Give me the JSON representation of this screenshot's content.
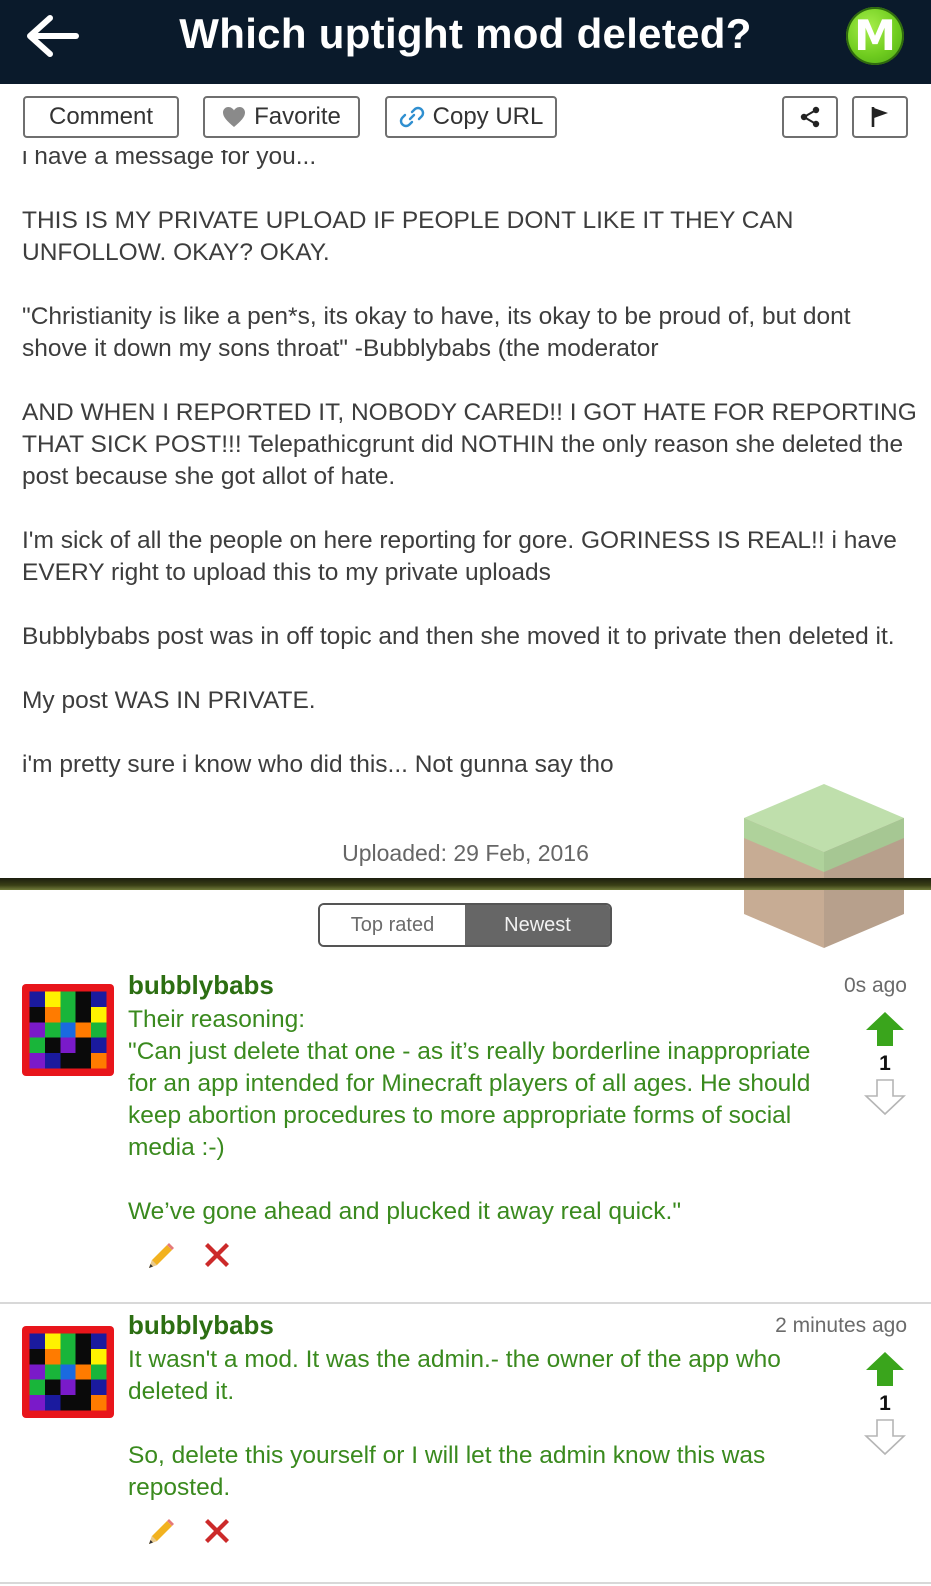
{
  "header": {
    "title": "Which uptight mod deleted?",
    "logo_letter": "M",
    "accent": "#0a1a2b",
    "logo_color": "#6fcc1f"
  },
  "toolbar": {
    "comment_label": "Comment",
    "favorite_label": "Favorite",
    "copy_url_label": "Copy URL"
  },
  "post": {
    "paragraphs": [
      "i have a message for you...",
      "THIS IS MY PRIVATE UPLOAD IF PEOPLE DONT LIKE IT THEY CAN UNFOLLOW. OKAY? OKAY.",
      "\"Christianity is like a pen*s, its okay to have, its okay to be proud of, but dont shove it down my sons throat\" -Bubblybabs (the moderator",
      "AND WHEN I REPORTED IT, NOBODY CARED!! I GOT HATE FOR REPORTING THAT SICK POST!!! Telepathicgrunt did NOTHIN the only reason she deleted the post because she got allot of hate.",
      "I'm sick of all the people on here reporting for gore. GORINESS IS REAL!! i have EVERY right to upload this to my private uploads",
      "Bubblybabs post was in off topic and then she moved it to private then deleted it.",
      "My post WAS IN PRIVATE.",
      "i'm pretty sure i know who did this... Not gunna say tho"
    ],
    "uploaded": "Uploaded: 29 Feb, 2016"
  },
  "sort_tabs": {
    "top_rated": "Top rated",
    "newest": "Newest",
    "selected": "Newest"
  },
  "comments": [
    {
      "user": "bubblybabs",
      "time": "0s ago",
      "paragraphs": [
        "Their reasoning:\n\"Can just delete that one - as it’s really borderline inappropriate for an app intended for Minecraft players of all ages. He should keep abortion procedures to more appropriate forms of social media :-)",
        "We’ve gone ahead and plucked it away real quick.\""
      ],
      "votes": "1"
    },
    {
      "user": "bubblybabs",
      "time": "2 minutes ago",
      "paragraphs": [
        "It wasn't a mod. It was the admin.- the owner of the app who deleted it.",
        "So, delete this yourself or I will let the admin know this was reposted."
      ],
      "votes": "1"
    }
  ],
  "colors": {
    "username": "#2c6e12",
    "comment_text": "#3a8a1e",
    "upvote": "#3aa51c",
    "delete": "#cc2a2a"
  }
}
